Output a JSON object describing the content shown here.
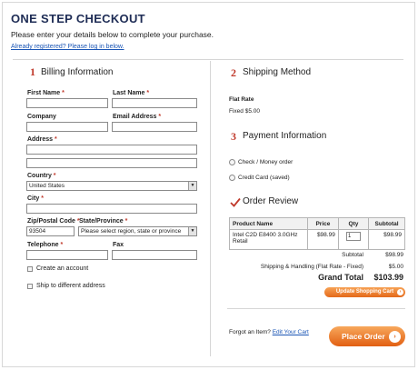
{
  "page": {
    "title": "ONE STEP CHECKOUT",
    "subtitle": "Please enter your details below to complete your purchase.",
    "login_link": "Already registered? Please log in below."
  },
  "billing": {
    "step_number": "1",
    "title": "Billing Information",
    "required_mark": "*",
    "first_name_label": "First Name",
    "last_name_label": "Last Name",
    "company_label": "Company",
    "email_label": "Email Address",
    "address_label": "Address",
    "country_label": "Country",
    "country_value": "United States",
    "city_label": "City",
    "zip_label": "Zip/Postal Code",
    "zip_value": "93504",
    "state_label": "State/Province",
    "state_value": "Please select region, state or province",
    "telephone_label": "Telephone",
    "fax_label": "Fax",
    "create_account_label": "Create an account",
    "ship_different_label": "Ship to different address"
  },
  "shipping": {
    "step_number": "2",
    "title": "Shipping Method",
    "method_name": "Flat Rate",
    "method_price": "Fixed $5.00"
  },
  "payment": {
    "step_number": "3",
    "title": "Payment Information",
    "option_check": "Check / Money order",
    "option_card": "Credit Card (saved)"
  },
  "review": {
    "title": "Order Review",
    "columns": [
      "Product Name",
      "Price",
      "Qty",
      "Subtotal"
    ],
    "rows": [
      {
        "product": "Intel C2D E8400 3.0GHz Retail",
        "price": "$98.99",
        "qty": "1",
        "subtotal": "$98.99"
      }
    ],
    "subtotal_label": "Subtotal",
    "subtotal_value": "$98.99",
    "shipping_label": "Shipping & Handling (Flat Rate - Fixed)",
    "shipping_value": "$5.00",
    "grand_total_label": "Grand Total",
    "grand_total_value": "$103.99",
    "update_cart_label": "Update Shopping Cart"
  },
  "footer": {
    "forgot_text": "Forgot an Item?",
    "edit_cart_link": "Edit Your Cart",
    "place_order_label": "Place Order"
  },
  "colors": {
    "accent_orange": "#e4691a",
    "title_navy": "#1e2c55",
    "step_number_red": "#c0392b",
    "link_blue": "#1a55b5"
  }
}
